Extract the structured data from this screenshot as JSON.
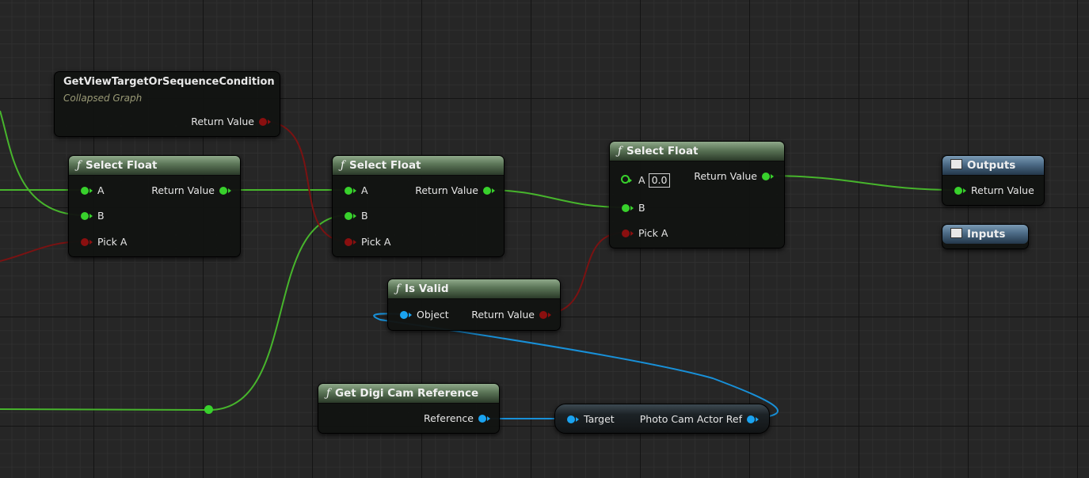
{
  "nodes": {
    "collapsed": {
      "title": "GetViewTargetOrSequenceCondition",
      "subtitle": "Collapsed Graph",
      "out": "Return Value"
    },
    "select1": {
      "title": "Select Float",
      "in_a": "A",
      "in_b": "B",
      "in_pick": "Pick A",
      "out": "Return Value"
    },
    "select2": {
      "title": "Select Float",
      "in_a": "A",
      "in_b": "B",
      "in_pick": "Pick A",
      "out": "Return Value"
    },
    "select3": {
      "title": "Select Float",
      "in_a": "A",
      "a_value": "0.0",
      "in_b": "B",
      "in_pick": "Pick A",
      "out": "Return Value"
    },
    "outputs": {
      "title": "Outputs",
      "in": "Return Value"
    },
    "inputs": {
      "title": "Inputs"
    },
    "isvalid": {
      "title": "Is Valid",
      "in": "Object",
      "out": "Return Value"
    },
    "getdigicam": {
      "title": "Get Digi Cam Reference",
      "out": "Reference"
    },
    "photocam": {
      "in": "Target",
      "out": "Photo Cam Actor Ref"
    }
  },
  "icons": {
    "function": "ƒ"
  },
  "colors": {
    "float_pin": "#38d12c",
    "bool_pin": "#8a0f0f",
    "object_pin": "#1aa3f0"
  }
}
